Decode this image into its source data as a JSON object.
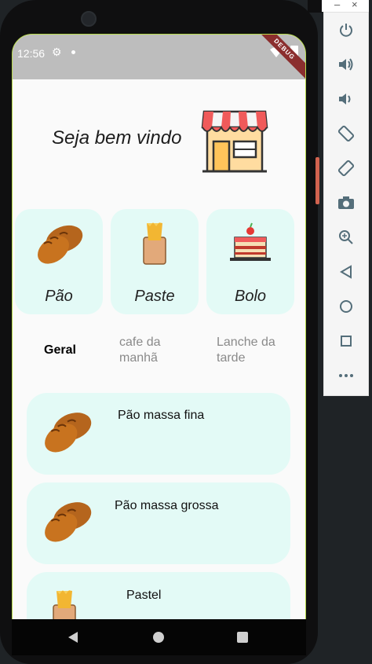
{
  "status": {
    "time": "12:56",
    "debug_label": "DEBUG"
  },
  "header": {
    "welcome": "Seja bem vindo"
  },
  "categories": [
    {
      "label": "Pão",
      "icon": "bread-icon"
    },
    {
      "label": "Paste",
      "icon": "pastel-icon"
    },
    {
      "label": "Bolo",
      "icon": "cake-icon"
    }
  ],
  "tabs": [
    {
      "line1": "Geral",
      "line2": "",
      "active": true
    },
    {
      "line1": "cafe da",
      "line2": "manhã",
      "active": false
    },
    {
      "line1": "Lanche da",
      "line2": "tarde",
      "active": false
    }
  ],
  "items": [
    {
      "label": "Pão massa fina",
      "icon": "bread-icon"
    },
    {
      "label": "Pão massa grossa",
      "icon": "bread-icon"
    },
    {
      "label": "Pastel",
      "icon": "pastel-icon"
    }
  ],
  "emulator": {
    "close": "×",
    "minimize": "–",
    "tools": [
      "power-icon",
      "volume-up-icon",
      "volume-down-icon",
      "rotate-left-icon",
      "rotate-right-icon",
      "camera-icon",
      "zoom-icon",
      "back-icon",
      "home-icon",
      "overview-icon",
      "more-icon"
    ]
  },
  "colors": {
    "card": "#e3faf6",
    "statusbar": "#bdbdbd",
    "accent": "#b6d94a"
  }
}
